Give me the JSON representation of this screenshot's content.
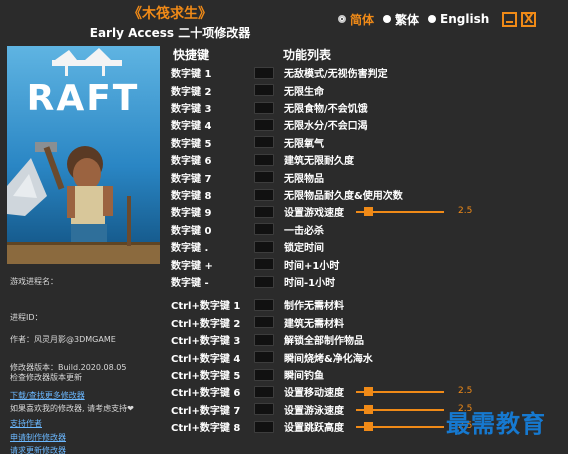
{
  "header": {
    "game_title": "《木筏求生》",
    "subtitle": "Early Access 二十项修改器"
  },
  "languages": [
    {
      "label": "简体",
      "selected": true
    },
    {
      "label": "繁体",
      "selected": false
    },
    {
      "label": "English",
      "selected": false
    }
  ],
  "window_controls": {
    "minimize_icon": "minimize-icon",
    "close_glyph": "X"
  },
  "cover": {
    "logo_text": "RAFT"
  },
  "left_panel": {
    "process_label": "游戏进程名：",
    "process_id_label": "进程ID：",
    "author": "作者：风灵月影@3DMGAME",
    "version": "修改器版本：Build.2020.08.05",
    "check_update": "检查修改器版本更新",
    "download_link": "下载/查找更多修改器",
    "support_text": "如果喜欢我的修改器, 请考虑支持❤",
    "support_author": "支持作者",
    "request_link": "申请制作修改器",
    "request_update": "请求更新修改器"
  },
  "columns": {
    "hotkey": "快捷键",
    "function": "功能列表"
  },
  "hotkeys": [
    {
      "key": "数字键 1",
      "func": "无敌模式/无视伤害判定"
    },
    {
      "key": "数字键 2",
      "func": "无限生命"
    },
    {
      "key": "数字键 3",
      "func": "无限食物/不会饥饿"
    },
    {
      "key": "数字键 4",
      "func": "无限水分/不会口渴"
    },
    {
      "key": "数字键 5",
      "func": "无限氧气"
    },
    {
      "key": "数字键 6",
      "func": "建筑无限耐久度"
    },
    {
      "key": "数字键 7",
      "func": "无限物品"
    },
    {
      "key": "数字键 8",
      "func": "无限物品耐久度&使用次数"
    },
    {
      "key": "数字键 9",
      "func": "设置游戏速度",
      "slider": 0.14,
      "value": "2.5"
    },
    {
      "key": "数字键 0",
      "func": "一击必杀"
    },
    {
      "key": "数字键 .",
      "func": "锁定时间"
    },
    {
      "key": "数字键 +",
      "func": "时间+1小时"
    },
    {
      "key": "数字键 -",
      "func": "时间-1小时"
    },
    {
      "key": "Ctrl+数字键 1",
      "func": "制作无需材料"
    },
    {
      "key": "Ctrl+数字键 2",
      "func": "建筑无需材料"
    },
    {
      "key": "Ctrl+数字键 3",
      "func": "解锁全部制作物品"
    },
    {
      "key": "Ctrl+数字键 4",
      "func": "瞬间烧烤&净化海水"
    },
    {
      "key": "Ctrl+数字键 5",
      "func": "瞬间钓鱼"
    },
    {
      "key": "Ctrl+数字键 6",
      "func": "设置移动速度",
      "slider": 0.14,
      "value": "2.5"
    },
    {
      "key": "Ctrl+数字键 7",
      "func": "设置游泳速度",
      "slider": 0.14,
      "value": "2.5"
    },
    {
      "key": "Ctrl+数字键 8",
      "func": "设置跳跃高度",
      "slider": 0.14,
      "value": "2.5"
    }
  ],
  "watermark": "最需教育",
  "colors": {
    "accent": "#f08a17",
    "background": "#2b2b2b",
    "link": "#6bb8ff",
    "watermark": "#1679d0"
  }
}
